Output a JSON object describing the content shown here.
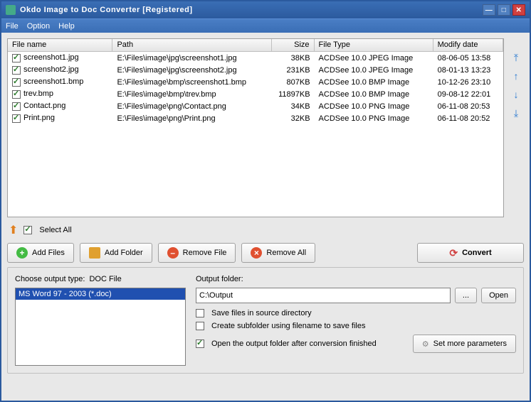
{
  "title": "Okdo Image to Doc Converter [Registered]",
  "menu": {
    "file": "File",
    "option": "Option",
    "help": "Help"
  },
  "columns": {
    "name": "File name",
    "path": "Path",
    "size": "Size",
    "type": "File Type",
    "date": "Modify date"
  },
  "files": [
    {
      "name": "screenshot1.jpg",
      "path": "E:\\Files\\image\\jpg\\screenshot1.jpg",
      "size": "38KB",
      "type": "ACDSee 10.0 JPEG Image",
      "date": "08-06-05 13:58"
    },
    {
      "name": "screenshot2.jpg",
      "path": "E:\\Files\\image\\jpg\\screenshot2.jpg",
      "size": "231KB",
      "type": "ACDSee 10.0 JPEG Image",
      "date": "08-01-13 13:23"
    },
    {
      "name": "screenshot1.bmp",
      "path": "E:\\Files\\image\\bmp\\screenshot1.bmp",
      "size": "807KB",
      "type": "ACDSee 10.0 BMP Image",
      "date": "10-12-26 23:10"
    },
    {
      "name": "trev.bmp",
      "path": "E:\\Files\\image\\bmp\\trev.bmp",
      "size": "11897KB",
      "type": "ACDSee 10.0 BMP Image",
      "date": "09-08-12 22:01"
    },
    {
      "name": "Contact.png",
      "path": "E:\\Files\\image\\png\\Contact.png",
      "size": "34KB",
      "type": "ACDSee 10.0 PNG Image",
      "date": "06-11-08 20:53"
    },
    {
      "name": "Print.png",
      "path": "E:\\Files\\image\\png\\Print.png",
      "size": "32KB",
      "type": "ACDSee 10.0 PNG Image",
      "date": "06-11-08 20:52"
    }
  ],
  "selectAll": "Select All",
  "buttons": {
    "addFiles": "Add Files",
    "addFolder": "Add Folder",
    "removeFile": "Remove File",
    "removeAll": "Remove All",
    "convert": "Convert"
  },
  "outputType": {
    "label": "Choose output type:",
    "value": "DOC File",
    "option": "MS Word 97 - 2003 (*.doc)"
  },
  "outputFolder": {
    "label": "Output folder:",
    "value": "C:\\Output",
    "browse": "...",
    "open": "Open"
  },
  "options": {
    "saveSource": "Save files in source directory",
    "subfolder": "Create subfolder using filename to save files",
    "openAfter": "Open the output folder after conversion finished"
  },
  "setParams": "Set more parameters"
}
